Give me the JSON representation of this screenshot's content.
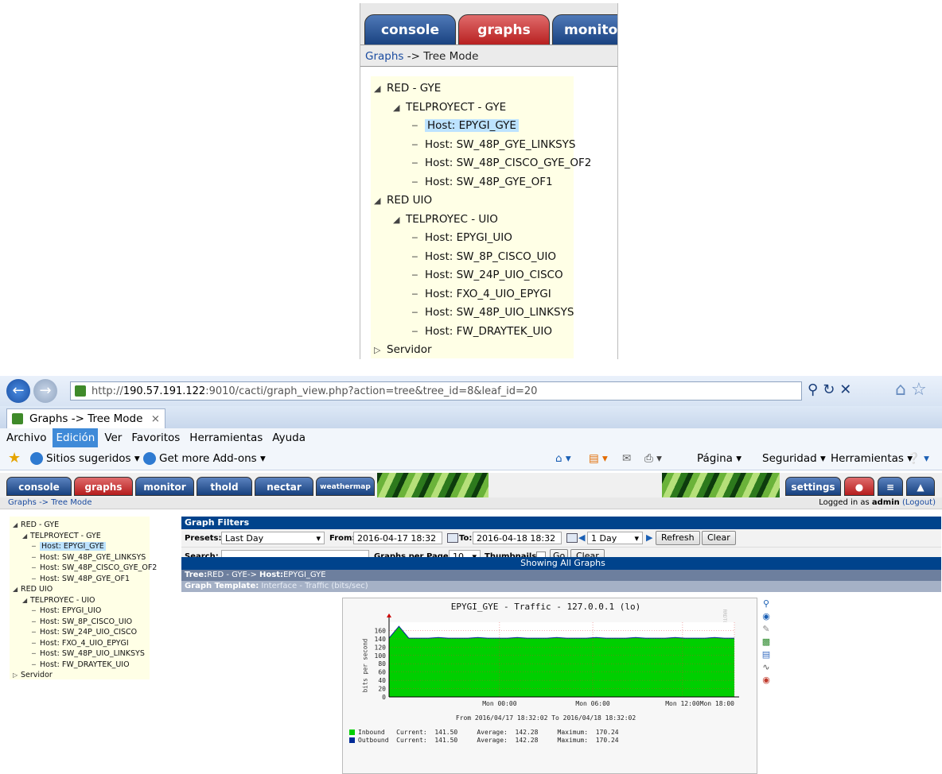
{
  "zoom": {
    "tabs": [
      "console",
      "graphs",
      "monito"
    ],
    "breadcrumb_link": "Graphs",
    "breadcrumb_rest": " -> Tree Mode",
    "tree": [
      {
        "label": "RED - GYE",
        "indent": 0,
        "twisty": "expanded"
      },
      {
        "label": "TELPROYECT - GYE",
        "indent": 1,
        "twisty": "expanded"
      },
      {
        "label": "Host: EPYGI_GYE",
        "indent": 2,
        "selected": true
      },
      {
        "label": "Host: SW_48P_GYE_LINKSYS",
        "indent": 2
      },
      {
        "label": "Host: SW_48P_CISCO_GYE_OF2",
        "indent": 2
      },
      {
        "label": "Host: SW_48P_GYE_OF1",
        "indent": 2
      },
      {
        "label": "RED UIO",
        "indent": 0,
        "twisty": "expanded"
      },
      {
        "label": "TELPROYEC - UIO",
        "indent": 1,
        "twisty": "expanded"
      },
      {
        "label": "Host: EPYGI_UIO",
        "indent": 2
      },
      {
        "label": "Host: SW_8P_CISCO_UIO",
        "indent": 2
      },
      {
        "label": "Host: SW_24P_UIO_CISCO",
        "indent": 2
      },
      {
        "label": "Host: FXO_4_UIO_EPYGI",
        "indent": 2
      },
      {
        "label": "Host: SW_48P_UIO_LINKSYS",
        "indent": 2
      },
      {
        "label": "Host: FW_DRAYTEK_UIO",
        "indent": 2
      },
      {
        "label": "Servidor",
        "indent": 0,
        "twisty": "collapsed"
      }
    ]
  },
  "browser": {
    "url_prefix": "http://",
    "url_host": "190.57.191.122",
    "url_rest": ":9010/cacti/graph_view.php?action=tree&tree_id=8&leaf_id=20",
    "tab_title": "Graphs -> Tree Mode",
    "menu": [
      "Archivo",
      "Edición",
      "Ver",
      "Favoritos",
      "Herramientas",
      "Ayuda"
    ],
    "menu_active": "Edición",
    "fav_suggested": "Sitios sugeridos ▾",
    "fav_addons": "Get more Add-ons ▾",
    "tool_page": "Página ▾",
    "tool_security": "Seguridad ▾",
    "tool_tools": "Herramientas ▾"
  },
  "cacti": {
    "tabs": [
      "console",
      "graphs",
      "monitor",
      "thold",
      "nectar",
      "weathermap"
    ],
    "settings_tab": "settings",
    "breadcrumb": "Graphs -> Tree Mode",
    "logged_in_prefix": "Logged in as ",
    "logged_in_user": "admin",
    "logout": "(Logout)",
    "tree": [
      {
        "label": "RED - GYE",
        "indent": 0,
        "twisty": "expanded"
      },
      {
        "label": "TELPROYECT - GYE",
        "indent": 1,
        "twisty": "expanded"
      },
      {
        "label": "Host: EPYGI_GYE",
        "indent": 2,
        "selected": true
      },
      {
        "label": "Host: SW_48P_GYE_LINKSYS",
        "indent": 2
      },
      {
        "label": "Host: SW_48P_CISCO_GYE_OF2",
        "indent": 2
      },
      {
        "label": "Host: SW_48P_GYE_OF1",
        "indent": 2
      },
      {
        "label": "RED UIO",
        "indent": 0,
        "twisty": "expanded"
      },
      {
        "label": "TELPROYEC - UIO",
        "indent": 1,
        "twisty": "expanded"
      },
      {
        "label": "Host: EPYGI_UIO",
        "indent": 2
      },
      {
        "label": "Host: SW_8P_CISCO_UIO",
        "indent": 2
      },
      {
        "label": "Host: SW_24P_UIO_CISCO",
        "indent": 2
      },
      {
        "label": "Host: FXO_4_UIO_EPYGI",
        "indent": 2
      },
      {
        "label": "Host: SW_48P_UIO_LINKSYS",
        "indent": 2
      },
      {
        "label": "Host: FW_DRAYTEK_UIO",
        "indent": 2
      },
      {
        "label": "Servidor",
        "indent": 0,
        "twisty": "collapsed"
      }
    ],
    "filters": {
      "title": "Graph Filters",
      "presets_label": "Presets:",
      "presets_value": "Last Day",
      "from_label": "From:",
      "from_value": "2016-04-17 18:32",
      "to_label": "To:",
      "to_value": "2016-04-18 18:32",
      "timespan_value": "1 Day",
      "refresh": "Refresh",
      "clear": "Clear",
      "search_label": "Search:",
      "search_value": "",
      "per_page_label": "Graphs per Page:",
      "per_page_value": "10",
      "thumbnails_label": "Thumbnails:",
      "go": "Go",
      "clear2": "Clear"
    },
    "showing": "Showing All Graphs",
    "tree_prefix": "Tree:",
    "tree_path": "RED - GYE-> ",
    "host_prefix": "Host:",
    "host_name": "EPYGI_GYE",
    "template_prefix": "Graph Template:",
    "template_name": " Interface - Traffic (bits/sec)"
  },
  "chart_data": {
    "type": "area",
    "title": "EPYGI_GYE - Traffic - 127.0.0.1 (lo)",
    "ylabel": "bits per second",
    "side_label": "RRDTOOL / TOBI OETIKER",
    "yticks": [
      0,
      20,
      40,
      60,
      80,
      100,
      120,
      140,
      160
    ],
    "ylim": [
      0,
      180
    ],
    "xticks": [
      "Mon 00:00",
      "Mon 06:00",
      "Mon 12:00",
      "Mon 18:00"
    ],
    "range_text": "From 2016/04/17 18:32:02 To 2016/04/18 18:32:02",
    "series": [
      {
        "name": "Inbound",
        "color": "#00cf00",
        "current": "141.50",
        "average": "142.28",
        "maximum": "170.24"
      },
      {
        "name": "Outbound",
        "color": "#002a97",
        "current": "141.50",
        "average": "142.28",
        "maximum": "170.24"
      }
    ],
    "values": [
      141.5,
      170.24,
      141.5,
      141.5,
      141.5,
      143,
      141.5,
      141.5,
      141.5,
      143,
      141.5,
      141.5,
      141.5,
      143,
      141.5,
      141.5,
      141.5,
      143,
      141.5,
      141.5,
      141.5,
      143,
      141.5,
      141.5,
      141.5,
      143,
      141.5,
      141.5,
      141.5,
      143,
      141.5,
      141.5,
      141.5,
      143,
      141.5,
      141.5
    ],
    "legend_labels": {
      "current": "Current:",
      "average": "Average:",
      "maximum": "Maximum:"
    }
  }
}
